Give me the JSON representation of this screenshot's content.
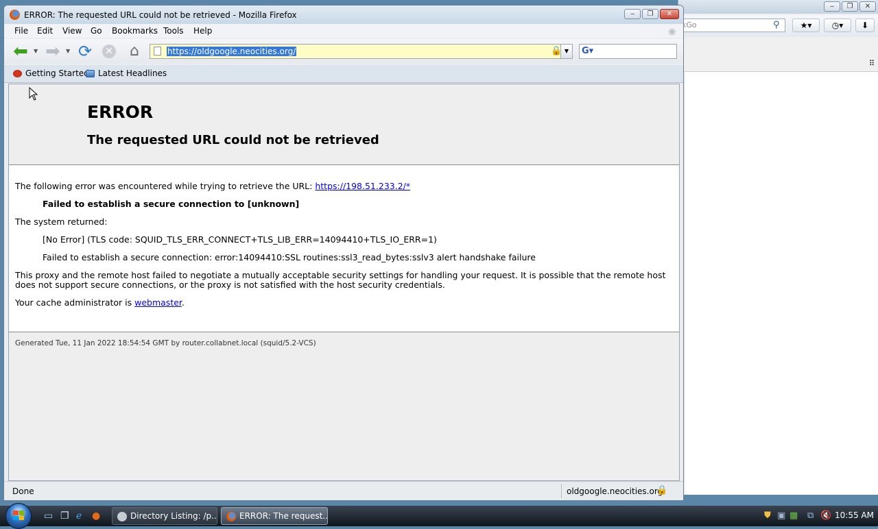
{
  "background_window": {
    "search_placeholder": "kGo",
    "controls": [
      "‒",
      "❐",
      "✕"
    ]
  },
  "window": {
    "title": "ERROR: The requested URL could not be retrieved - Mozilla Firefox",
    "controls": {
      "minimize": "‒",
      "maximize": "❐",
      "close": "✕"
    }
  },
  "menu": [
    "File",
    "Edit",
    "View",
    "Go",
    "Bookmarks",
    "Tools",
    "Help"
  ],
  "navigation": {
    "url": "https://oldgoogle.neocities.org/",
    "search_value": ""
  },
  "bookmarks": [
    {
      "label": "Getting Started",
      "icon": "firefox-bookmark-icon"
    },
    {
      "label": "Latest Headlines",
      "icon": "rss-folder-icon"
    }
  ],
  "page": {
    "title": "ERROR",
    "subtitle": "The requested URL could not be retrieved",
    "intro": "The following error was encountered while trying to retrieve the URL: ",
    "error_url": "https://198.51.233.2/*",
    "failure": "Failed to establish a secure connection to [unknown]",
    "system_returned": "The system returned:",
    "tls_code": "[No Error] (TLS code: SQUID_TLS_ERR_CONNECT+TLS_LIB_ERR=14094410+TLS_IO_ERR=1)",
    "ssl_detail": "Failed to establish a secure connection: error:14094410:SSL routines:ssl3_read_bytes:sslv3 alert handshake failure",
    "explanation_line1": "This proxy and the remote host failed to negotiate a mutually acceptable security settings for handling your request. It is possible that the remote host",
    "explanation_line2": "does not support secure connections, or the proxy is not satisfied with the host security credentials.",
    "admin_prefix": "Your cache administrator is ",
    "admin_link": "webmaster",
    "admin_suffix": ".",
    "generated": "Generated Tue, 11 Jan 2022 18:54:54 GMT by router.collabnet.local (squid/5.2-VCS)"
  },
  "status": {
    "text": "Done",
    "host": "oldgoogle.neocities.org"
  },
  "taskbar": {
    "tasks": [
      {
        "label": "Directory Listing: /p...",
        "icon": "directory-listing-icon"
      },
      {
        "label": "ERROR: The request...",
        "icon": "firefox-icon",
        "active": true
      }
    ],
    "clock": "10:55 AM"
  },
  "colors": {
    "link": "#0000ee",
    "url_selection": "#3478d8",
    "urlbar_secure": "#fffdc6",
    "back_arrow": "#3fa01f"
  }
}
